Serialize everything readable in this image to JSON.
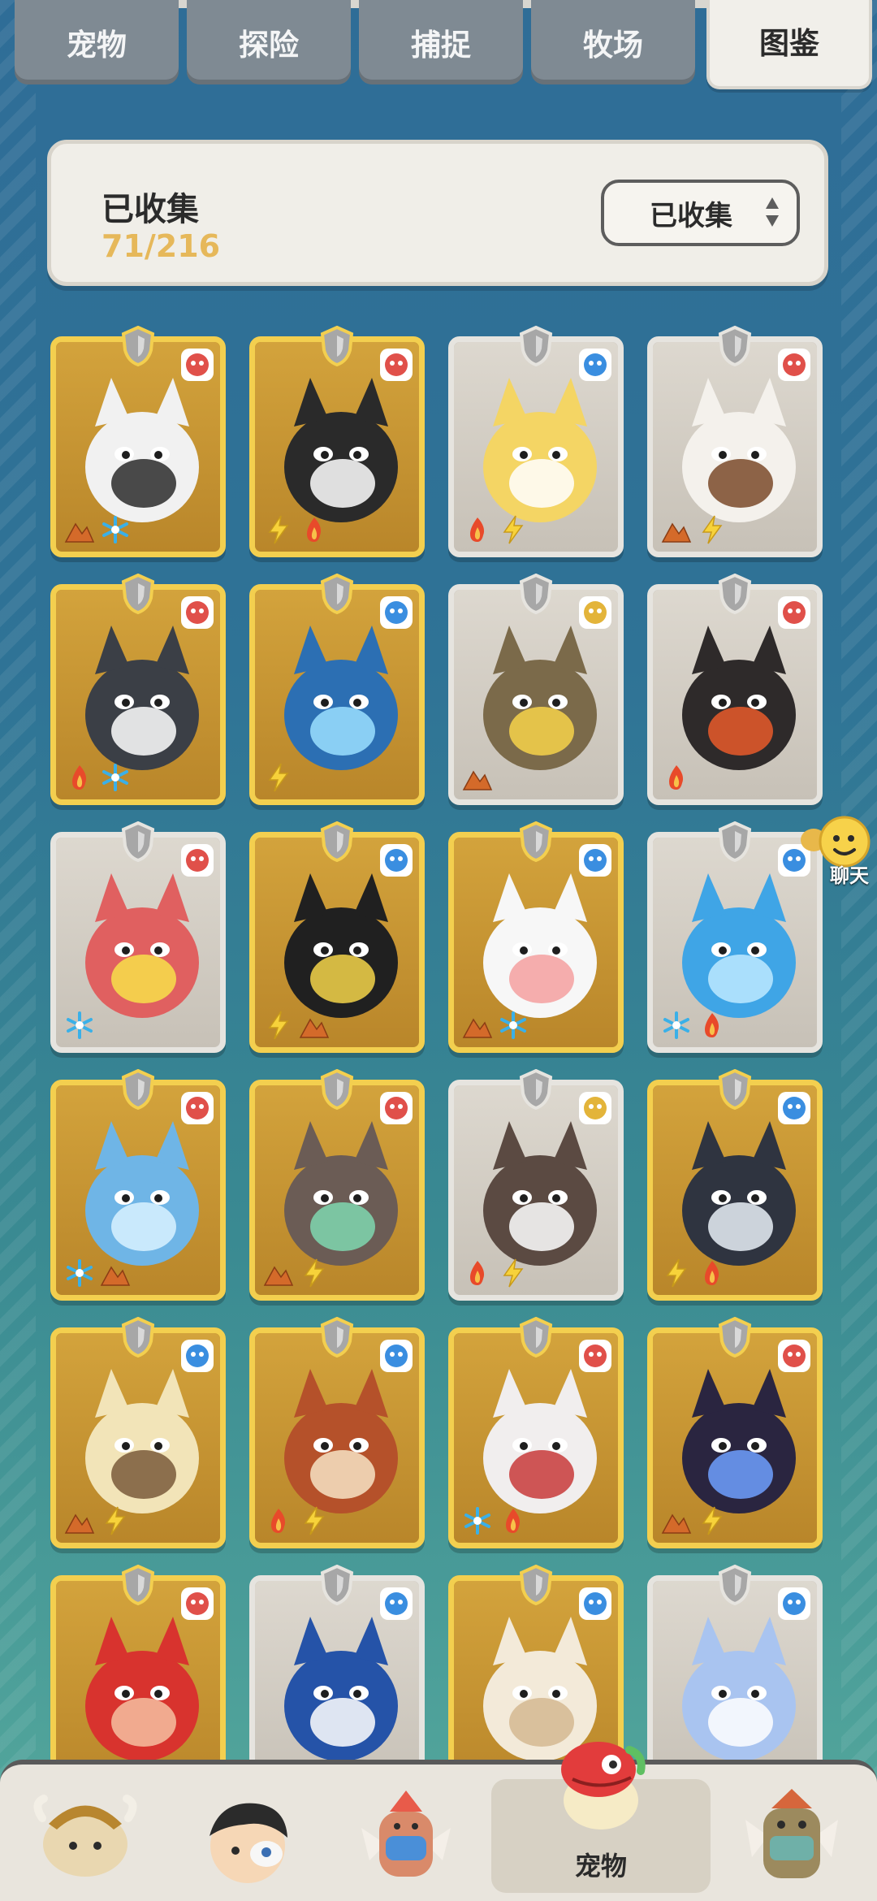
{
  "tabs": [
    {
      "label": "宠物",
      "active": false
    },
    {
      "label": "探险",
      "active": false
    },
    {
      "label": "捕捉",
      "active": false
    },
    {
      "label": "牧场",
      "active": false
    },
    {
      "label": "图鉴",
      "active": true
    }
  ],
  "collection": {
    "title": "已收集",
    "count": "71/216",
    "filter_value": "已收集"
  },
  "colors": {
    "gold": "#f3cf4f",
    "silver": "#e6e4df",
    "count": "#e6b85a"
  },
  "cards": [
    {
      "creature": "panda",
      "rarity": "gold",
      "type": "fire",
      "elements": [
        "ground",
        "ice"
      ],
      "color": "#f1f1f1",
      "accent": "#2b2b2b"
    },
    {
      "creature": "jackal-ninja",
      "rarity": "gold",
      "type": "fire",
      "elements": [
        "electric",
        "fire"
      ],
      "color": "#2a2a2a",
      "accent": "#ffffff"
    },
    {
      "creature": "yellow-bunny",
      "rarity": "silver",
      "type": "water",
      "elements": [
        "fire",
        "electric"
      ],
      "color": "#f4d564",
      "accent": "#ffffff"
    },
    {
      "creature": "white-cat",
      "rarity": "silver",
      "type": "fire",
      "elements": [
        "ground",
        "electric"
      ],
      "color": "#f4f1ec",
      "accent": "#7a4a2a"
    },
    {
      "creature": "dark-wolf",
      "rarity": "gold",
      "type": "fire",
      "elements": [
        "fire",
        "ice"
      ],
      "color": "#3b3f46",
      "accent": "#ffffff"
    },
    {
      "creature": "blue-dragon",
      "rarity": "gold",
      "type": "water",
      "elements": [
        "electric"
      ],
      "color": "#2c6fb3",
      "accent": "#9be0ff"
    },
    {
      "creature": "rock-lizard",
      "rarity": "silver",
      "type": "dark",
      "elements": [
        "ground"
      ],
      "color": "#7b6a4a",
      "accent": "#f7d24a"
    },
    {
      "creature": "lava-dragon",
      "rarity": "silver",
      "type": "fire",
      "elements": [
        "fire"
      ],
      "color": "#2e2a2a",
      "accent": "#e85b2a"
    },
    {
      "creature": "tengu-beast",
      "rarity": "silver",
      "type": "fire",
      "elements": [
        "ice"
      ],
      "color": "#e06060",
      "accent": "#f7e04a"
    },
    {
      "creature": "dark-puff",
      "rarity": "gold",
      "type": "water",
      "elements": [
        "electric",
        "ground"
      ],
      "color": "#202020",
      "accent": "#f4d54a"
    },
    {
      "creature": "snow-puff",
      "rarity": "gold",
      "type": "water",
      "elements": [
        "ground",
        "ice"
      ],
      "color": "#f7f7f7",
      "accent": "#f4a0a0"
    },
    {
      "creature": "ice-dragon",
      "rarity": "silver",
      "type": "water",
      "elements": [
        "ice",
        "fire"
      ],
      "color": "#3fa5e6",
      "accent": "#bde9ff"
    },
    {
      "creature": "frost-dragon",
      "rarity": "gold",
      "type": "fire",
      "elements": [
        "ice",
        "ground"
      ],
      "color": "#6fb5e6",
      "accent": "#d9f2ff"
    },
    {
      "creature": "earth-dragon",
      "rarity": "gold",
      "type": "fire",
      "elements": [
        "ground",
        "electric"
      ],
      "color": "#6b5c55",
      "accent": "#7fd7b0"
    },
    {
      "creature": "stone-bear",
      "rarity": "silver",
      "type": "dark",
      "elements": [
        "fire",
        "electric"
      ],
      "color": "#5b4a42",
      "accent": "#ffffff"
    },
    {
      "creature": "shadow-fox",
      "rarity": "gold",
      "type": "water",
      "elements": [
        "electric",
        "fire"
      ],
      "color": "#2f3440",
      "accent": "#e8f0f7"
    },
    {
      "creature": "sand-lion",
      "rarity": "gold",
      "type": "water",
      "elements": [
        "ground",
        "electric"
      ],
      "color": "#f2e4b8",
      "accent": "#7a5a3a"
    },
    {
      "creature": "ember-fox",
      "rarity": "gold",
      "type": "water",
      "elements": [
        "fire",
        "electric"
      ],
      "color": "#b5512a",
      "accent": "#f7e3c4"
    },
    {
      "creature": "white-wyvern",
      "rarity": "gold",
      "type": "fire",
      "elements": [
        "ice",
        "fire"
      ],
      "color": "#f1eeee",
      "accent": "#c83a3a"
    },
    {
      "creature": "void-dragon",
      "rarity": "gold",
      "type": "fire",
      "elements": [
        "ground",
        "electric"
      ],
      "color": "#2a2540",
      "accent": "#6fa0ff"
    },
    {
      "creature": "crimson-dragon",
      "rarity": "gold",
      "type": "fire",
      "elements": [],
      "color": "#d8332e",
      "accent": "#f6c0a0"
    },
    {
      "creature": "blue-penguin",
      "rarity": "silver",
      "type": "water",
      "elements": [],
      "color": "#2553a8",
      "accent": "#ffffff"
    },
    {
      "creature": "cream-squirrel",
      "rarity": "gold",
      "type": "water",
      "elements": [],
      "color": "#f3ead9",
      "accent": "#d4b890"
    },
    {
      "creature": "blue-blob",
      "rarity": "silver",
      "type": "water",
      "elements": [],
      "color": "#a9c4f0",
      "accent": "#ffffff"
    }
  ],
  "chat": {
    "label": "聊天"
  },
  "bottom_nav": [
    {
      "name": "nav-yak",
      "active": false,
      "label": ""
    },
    {
      "name": "nav-trainer",
      "active": false,
      "label": ""
    },
    {
      "name": "nav-totem",
      "active": false,
      "label": ""
    },
    {
      "name": "nav-pets",
      "active": true,
      "label": "宠物"
    },
    {
      "name": "nav-guardian",
      "active": false,
      "label": ""
    }
  ]
}
